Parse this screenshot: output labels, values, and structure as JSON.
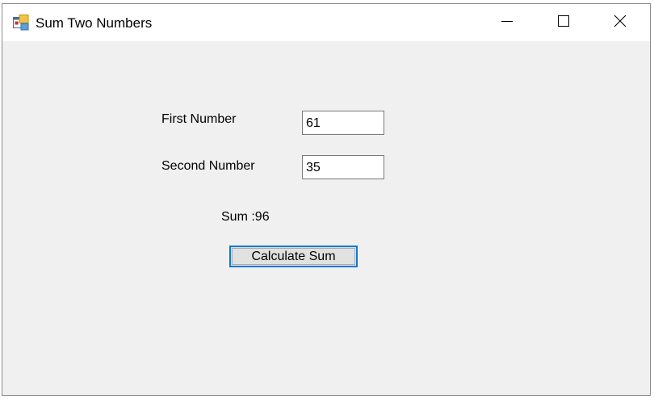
{
  "window": {
    "title": "Sum Two Numbers"
  },
  "form": {
    "first_label": "First Number",
    "first_value": "61",
    "second_label": "Second Number",
    "second_value": "35",
    "sum_text": "Sum :96",
    "calculate_label": "Calculate Sum"
  },
  "icons": {
    "app": "application-icon",
    "minimize": "minimize-icon",
    "maximize": "maximize-icon",
    "close": "close-icon"
  },
  "colors": {
    "client_background": "#f0f0f0",
    "button_focus_border": "#0a78d7"
  }
}
